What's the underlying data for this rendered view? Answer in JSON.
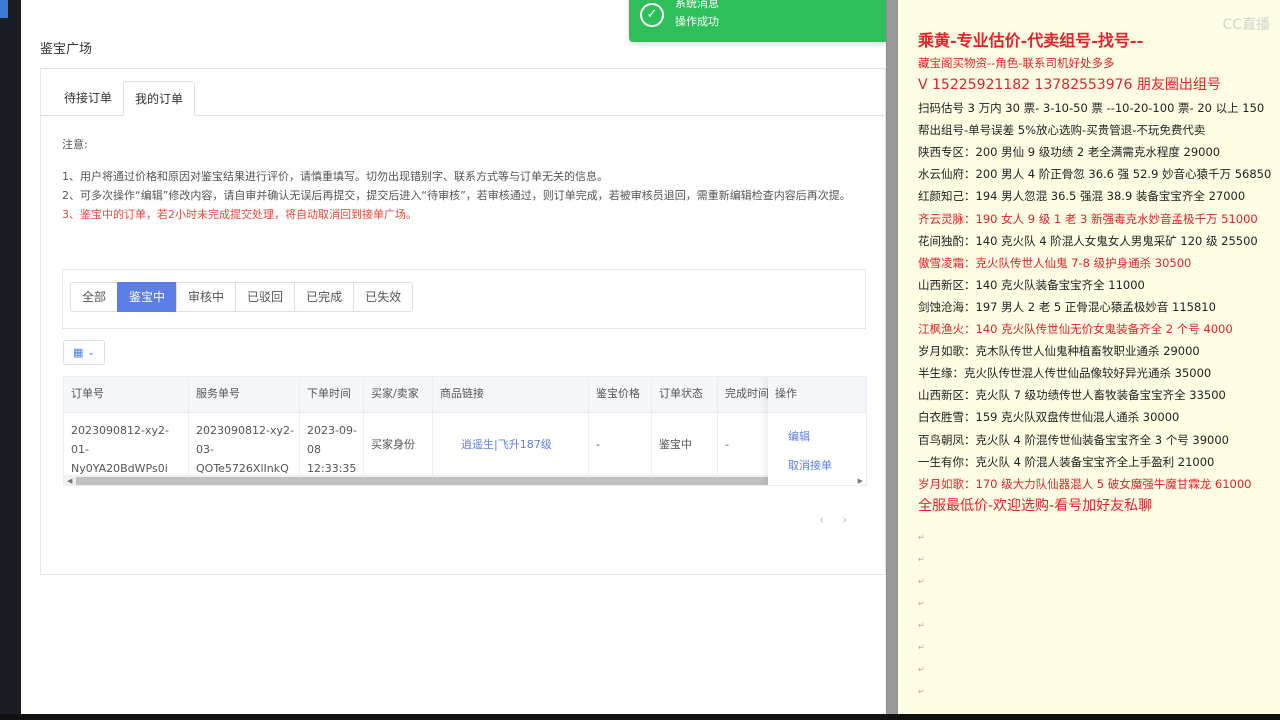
{
  "page": {
    "title": "鉴宝广场",
    "tabs": [
      {
        "label": "待接订单"
      },
      {
        "label": "我的订单"
      }
    ]
  },
  "notes": {
    "title": "注意:",
    "line1": "1、用户将通过价格和原因对鉴宝结果进行评价，请慎重填写。切勿出现错别字、联系方式等与订单无关的信息。",
    "line2": "2、可多次操作“编辑”修改内容，请自审并确认无误后再提交，提交后进入“待审核”，若审核通过，则订单完成，若被审核员退回，需重新编辑检查内容后再次提。",
    "line3": "3、鉴宝中的订单，若2小时未完成提交处理，将自动取消回到接单广场。"
  },
  "filters": {
    "options": [
      {
        "label": "全部"
      },
      {
        "label": "鉴宝中"
      },
      {
        "label": "审核中"
      },
      {
        "label": "已驳回"
      },
      {
        "label": "已完成"
      },
      {
        "label": "已失效"
      }
    ],
    "selected": "鉴宝中"
  },
  "table": {
    "headers": {
      "order_no": "订单号",
      "service_no": "服务单号",
      "order_time": "下单时间",
      "role": "买家/卖家",
      "product_link": "商品链接",
      "price": "鉴宝价格",
      "status": "订单状态",
      "done_time": "完成时间",
      "ops": "操作"
    },
    "rows": [
      {
        "order_no_1": "2023090812-xy2-",
        "order_no_2": "01-",
        "order_no_3": "Ny0YA20BdWPs0i",
        "service_no_1": "2023090812-xy2-",
        "service_no_2": "03-",
        "service_no_3": "QOTe5726XlInkQ",
        "time_1": "2023-09-",
        "time_2": "08",
        "time_3": "12:33:35",
        "role": "买家身份",
        "product_link": "逍遥生|飞升187级",
        "price": "-",
        "status": "鉴宝中",
        "done_time": "-",
        "op_edit": "编辑",
        "op_cancel": "取消接单"
      }
    ]
  },
  "toast": {
    "title": "系统消息",
    "message": "操作成功"
  },
  "doc": {
    "watermark": "CC直播",
    "lines": [
      {
        "text": "乘黄-专业估价-代卖组号-找号--",
        "style": "big"
      },
      {
        "text": "藏宝阁买物资--角色-联系司机好处多多",
        "style": "red"
      },
      {
        "text": "V 15225921182   13782553976 朋友圈出组号",
        "style": "mid"
      },
      {
        "text": "扫码估号 3 万内 30 票- 3-10-50 票  --10-20-100 票- 20 以上 150",
        "style": ""
      },
      {
        "text": "帮出组号-单号误差 5%放心选购-买贵管退-不玩免费代卖",
        "style": ""
      },
      {
        "text": "陕西专区：200 男仙 9 级功绩 2 老全满需克水程度 29000",
        "style": ""
      },
      {
        "text": "水云仙府：200 男人 4 阶正骨忽 36.6 强 52.9 妙音心猿千万 56850",
        "style": ""
      },
      {
        "text": "红颜知己：194 男人忽混 36.5 强混 38.9 装备宝宝齐全 27000",
        "style": ""
      },
      {
        "text": "齐云灵脉：190 女人 9 级 1 老 3 新强毒克水妙音孟极千万 51000",
        "style": "red"
      },
      {
        "text": "花间独酌：140 克火队 4 阶混人女鬼女人男鬼采矿 120 级 25500",
        "style": ""
      },
      {
        "text": "傲雪凌霜：克火队传世人仙鬼 7-8 级护身通杀 30500",
        "style": "red"
      },
      {
        "text": "山西新区：140 克火队装备宝宝齐全 11000",
        "style": ""
      },
      {
        "text": "剑蚀沧海：197 男人 2 老 5 正骨混心猿孟极妙音 115810",
        "style": ""
      },
      {
        "text": "江枫渔火：140 克火队传世仙无价女鬼装备齐全 2 个号 4000",
        "style": "red"
      },
      {
        "text": "岁月如歌：克木队传世人仙鬼种植畜牧职业通杀 29000",
        "style": ""
      },
      {
        "text": "半生缘：克火队传世混人传世仙品像较好异光通杀 35000",
        "style": ""
      },
      {
        "text": "山西新区：克火队 7 级功绩传世人畜牧装备宝宝齐全 33500",
        "style": ""
      },
      {
        "text": "白衣胜雪：159 克火队双盘传世仙混人通杀 30000",
        "style": ""
      },
      {
        "text": "百鸟朝凤：克火队 4 阶混传世仙装备宝宝齐全 3 个号 39000",
        "style": ""
      },
      {
        "text": "一生有你：克火队 4 阶混人装备宝宝齐全上手盈利 21000",
        "style": ""
      },
      {
        "text": "岁月如歌：170 级大力队仙器混人 5 破女魔强牛魔甘霖龙 61000",
        "style": "red"
      },
      {
        "text": "全服最低价-欢迎选购-看号加好友私聊",
        "style": "mid"
      }
    ]
  },
  "colors": {
    "primary": "#5b7fe6",
    "success_toast": "#2fbf5a",
    "notice_red": "#f0463c",
    "doc_red": "#e8202a",
    "doc_bg": "#fffde3"
  }
}
